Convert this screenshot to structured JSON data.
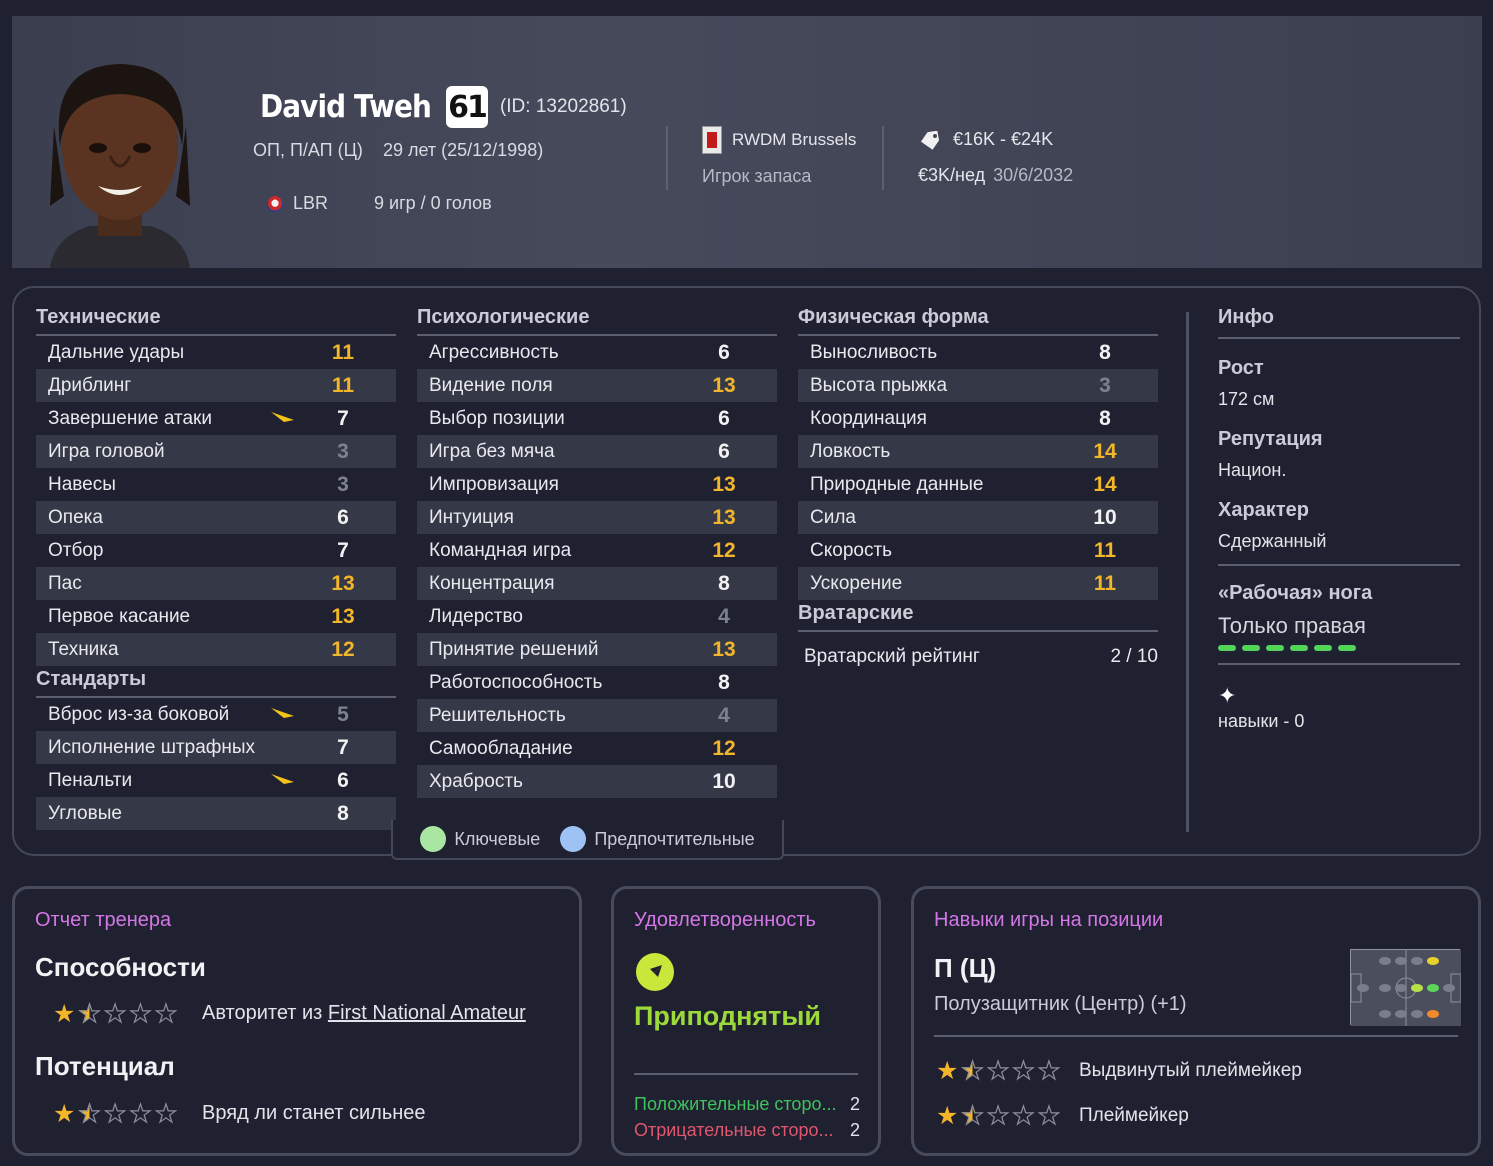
{
  "header": {
    "name": "David Tweh",
    "rating": "61",
    "id_text": "(ID: 13202861)",
    "positions": "ОП, П/АП (Ц)",
    "age": "29 лет (25/12/1998)",
    "nation": "LBR",
    "caps": "9 игр / 0 голов",
    "club": "RWDM Brussels",
    "squad_status": "Игрок запаса",
    "value": "€16K - €24K",
    "wage": "€3K/нед",
    "contract_end": "30/6/2032"
  },
  "technical": {
    "title": "Технические",
    "rows": [
      {
        "label": "Дальние удары",
        "value": "11",
        "color": "gold"
      },
      {
        "label": "Дриблинг",
        "value": "11",
        "color": "gold"
      },
      {
        "label": "Завершение атаки",
        "value": "7",
        "color": "white",
        "trend": true
      },
      {
        "label": "Игра головой",
        "value": "3",
        "color": "grey"
      },
      {
        "label": "Навесы",
        "value": "3",
        "color": "grey"
      },
      {
        "label": "Опека",
        "value": "6",
        "color": "white"
      },
      {
        "label": "Отбор",
        "value": "7",
        "color": "white"
      },
      {
        "label": "Пас",
        "value": "13",
        "color": "gold"
      },
      {
        "label": "Первое касание",
        "value": "13",
        "color": "gold"
      },
      {
        "label": "Техника",
        "value": "12",
        "color": "gold"
      }
    ]
  },
  "set_pieces": {
    "title": "Стандарты",
    "rows": [
      {
        "label": "Вброс из-за боковой",
        "value": "5",
        "color": "grey",
        "trend": true
      },
      {
        "label": "Исполнение штрафных",
        "value": "7",
        "color": "white"
      },
      {
        "label": "Пенальти",
        "value": "6",
        "color": "white",
        "trend": true
      },
      {
        "label": "Угловые",
        "value": "8",
        "color": "white"
      }
    ]
  },
  "mental": {
    "title": "Психологические",
    "rows": [
      {
        "label": "Агрессивность",
        "value": "6",
        "color": "white"
      },
      {
        "label": "Видение поля",
        "value": "13",
        "color": "gold"
      },
      {
        "label": "Выбор позиции",
        "value": "6",
        "color": "white"
      },
      {
        "label": "Игра без мяча",
        "value": "6",
        "color": "white"
      },
      {
        "label": "Импровизация",
        "value": "13",
        "color": "gold"
      },
      {
        "label": "Интуиция",
        "value": "13",
        "color": "gold"
      },
      {
        "label": "Командная игра",
        "value": "12",
        "color": "gold"
      },
      {
        "label": "Концентрация",
        "value": "8",
        "color": "white"
      },
      {
        "label": "Лидерство",
        "value": "4",
        "color": "grey"
      },
      {
        "label": "Принятие решений",
        "value": "13",
        "color": "gold"
      },
      {
        "label": "Работоспособность",
        "value": "8",
        "color": "white"
      },
      {
        "label": "Решительность",
        "value": "4",
        "color": "grey"
      },
      {
        "label": "Самообладание",
        "value": "12",
        "color": "gold"
      },
      {
        "label": "Храбрость",
        "value": "10",
        "color": "white"
      }
    ]
  },
  "physical": {
    "title": "Физическая форма",
    "rows": [
      {
        "label": "Выносливость",
        "value": "8",
        "color": "white"
      },
      {
        "label": "Высота прыжка",
        "value": "3",
        "color": "grey"
      },
      {
        "label": "Координация",
        "value": "8",
        "color": "white"
      },
      {
        "label": "Ловкость",
        "value": "14",
        "color": "gold"
      },
      {
        "label": "Природные данные",
        "value": "14",
        "color": "gold"
      },
      {
        "label": "Сила",
        "value": "10",
        "color": "white"
      },
      {
        "label": "Скорость",
        "value": "11",
        "color": "gold"
      },
      {
        "label": "Ускорение",
        "value": "11",
        "color": "gold"
      }
    ]
  },
  "goalkeeping": {
    "title": "Вратарские",
    "label": "Вратарский рейтинг",
    "value": "2 / 10"
  },
  "info": {
    "title": "Инфо",
    "height_label": "Рост",
    "height": "172 см",
    "reputation_label": "Репутация",
    "reputation": "Национ.",
    "personality_label": "Характер",
    "personality": "Сдержанный",
    "foot_label": "«Рабочая» нога",
    "foot": "Только правая",
    "skills": "навыки - 0"
  },
  "legend": {
    "key": "Ключевые",
    "preferred": "Предпочтительные"
  },
  "coach_report": {
    "title": "Отчет тренера",
    "ability_label": "Способности",
    "ability_stars": 1.5,
    "ability_text": "Авторитет из ",
    "ability_link": "First National Amateur",
    "potential_label": "Потенциал",
    "potential_stars": 1.5,
    "potential_text": "Вряд ли станет сильнее"
  },
  "morale": {
    "title": "Удовлетворенность",
    "value": "Приподнятый",
    "positive_label": "Положительные сторо...",
    "positive_count": "2",
    "negative_label": "Отрицательные сторо...",
    "negative_count": "2",
    "accent": "#c7e83a"
  },
  "position_skills": {
    "title": "Навыки игры на позиции",
    "code": "П (Ц)",
    "full": "Полузащитник (Центр) (+1)",
    "roles": [
      {
        "name": "Выдвинутый плеймейкер",
        "stars": 1.5
      },
      {
        "name": "Плеймейкер",
        "stars": 1.5
      }
    ]
  },
  "colors": {
    "gold": "#f3b52a",
    "grey": "#7e8190",
    "purple": "#d476e6"
  }
}
